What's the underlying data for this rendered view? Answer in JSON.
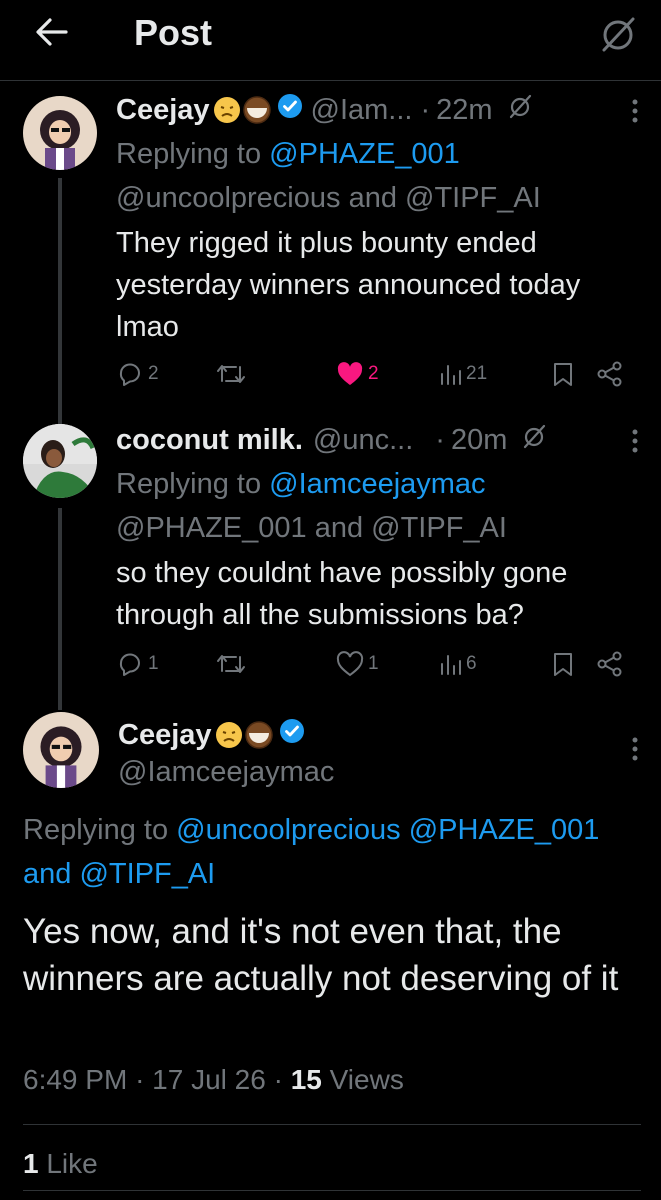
{
  "header": {
    "title": "Post",
    "back_icon": "arrow-left-icon",
    "grok_icon": "grok-icon"
  },
  "tweets": [
    {
      "name": "Ceejay",
      "handle": "@Iam...",
      "time": "22m",
      "reply_prefix": "Replying to",
      "mentions_line1": "@PHAZE_001",
      "mentions_line2": "@uncoolprecious and @TIPF_AI",
      "text": "They rigged it plus bounty ended yesterday winners announced today lmao",
      "replies": "2",
      "retweets": "",
      "likes": "2",
      "views": "21",
      "liked": true
    },
    {
      "name": "coconut milk.",
      "handle": "@unc...",
      "time": "20m",
      "reply_prefix": "Replying to",
      "mentions_line1": "@Iamceejaymac",
      "mentions_line2": "@PHAZE_001 and @TIPF_AI",
      "text": "so they couldnt have possibly gone through all the submissions ba?",
      "replies": "1",
      "retweets": "",
      "likes": "1",
      "views": "6",
      "liked": false
    }
  ],
  "main": {
    "name": "Ceejay",
    "handle": "@Iamceejaymac",
    "reply_prefix": "Replying to",
    "mentions_line1": "@uncoolprecious @PHAZE_001",
    "mentions_line2": "and @TIPF_AI",
    "text": "Yes now, and it's not even that, the winners are actually not deserving of it",
    "time": "6:49 PM",
    "date": "17 Jul 26",
    "views_count": "15",
    "views_label": "Views",
    "like_count": "1",
    "like_label": "Like"
  },
  "colors": {
    "accent": "#1d9bf0",
    "like": "#f91880",
    "muted": "#71767b",
    "text": "#e7e9ea"
  }
}
